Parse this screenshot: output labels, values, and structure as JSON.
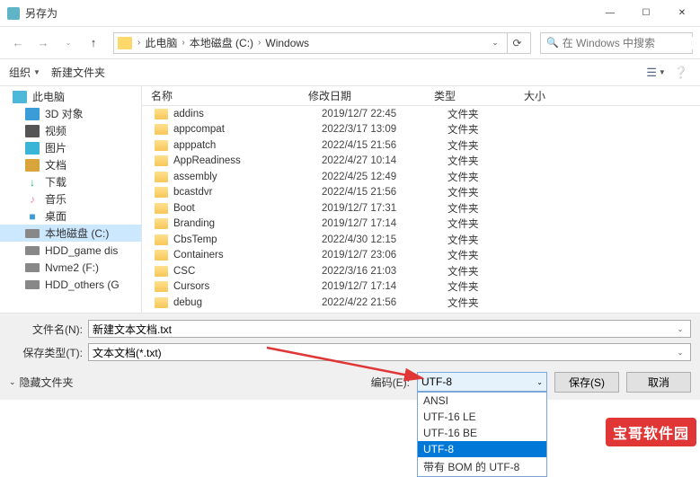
{
  "window": {
    "title": "另存为",
    "close": "✕",
    "max": "☐",
    "min": "—"
  },
  "nav": {
    "back": "←",
    "fwd": "→",
    "up": "↑",
    "crumbs": [
      "此电脑",
      "本地磁盘 (C:)",
      "Windows"
    ],
    "sep": "›",
    "refresh": "⟳",
    "search_placeholder": "在 Windows 中搜索",
    "search_icon": "🔍"
  },
  "toolbar": {
    "organize": "组织",
    "newfolder": "新建文件夹",
    "view_icon": "☰",
    "help_icon": "❔"
  },
  "sidebar": {
    "items": [
      {
        "label": "此电脑",
        "cls": "ic-pc"
      },
      {
        "label": "3D 对象",
        "cls": "ic-3d",
        "sub": true
      },
      {
        "label": "视频",
        "cls": "ic-vid",
        "sub": true
      },
      {
        "label": "图片",
        "cls": "ic-img",
        "sub": true
      },
      {
        "label": "文档",
        "cls": "ic-doc",
        "sub": true
      },
      {
        "label": "下载",
        "cls": "ic-dl",
        "sub": true,
        "glyph": "↓"
      },
      {
        "label": "音乐",
        "cls": "ic-mus",
        "sub": true,
        "glyph": "♪"
      },
      {
        "label": "桌面",
        "cls": "ic-desk",
        "sub": true,
        "glyph": "■"
      },
      {
        "label": "本地磁盘 (C:)",
        "cls": "ic-disk",
        "sub": true,
        "sel": true
      },
      {
        "label": "HDD_game dis",
        "cls": "ic-disk",
        "sub": true
      },
      {
        "label": "Nvme2 (F:)",
        "cls": "ic-disk",
        "sub": true
      },
      {
        "label": "HDD_others (G",
        "cls": "ic-disk",
        "sub": true
      }
    ]
  },
  "columns": {
    "name": "名称",
    "date": "修改日期",
    "type": "类型",
    "size": "大小"
  },
  "files": [
    {
      "name": "addins",
      "date": "2019/12/7 22:45",
      "type": "文件夹"
    },
    {
      "name": "appcompat",
      "date": "2022/3/17 13:09",
      "type": "文件夹"
    },
    {
      "name": "apppatch",
      "date": "2022/4/15 21:56",
      "type": "文件夹"
    },
    {
      "name": "AppReadiness",
      "date": "2022/4/27 10:14",
      "type": "文件夹"
    },
    {
      "name": "assembly",
      "date": "2022/4/25 12:49",
      "type": "文件夹"
    },
    {
      "name": "bcastdvr",
      "date": "2022/4/15 21:56",
      "type": "文件夹"
    },
    {
      "name": "Boot",
      "date": "2019/12/7 17:31",
      "type": "文件夹"
    },
    {
      "name": "Branding",
      "date": "2019/12/7 17:14",
      "type": "文件夹"
    },
    {
      "name": "CbsTemp",
      "date": "2022/4/30 12:15",
      "type": "文件夹"
    },
    {
      "name": "Containers",
      "date": "2019/12/7 23:06",
      "type": "文件夹"
    },
    {
      "name": "CSC",
      "date": "2022/3/16 21:03",
      "type": "文件夹"
    },
    {
      "name": "Cursors",
      "date": "2019/12/7 17:14",
      "type": "文件夹"
    },
    {
      "name": "debug",
      "date": "2022/4/22 21:56",
      "type": "文件夹"
    }
  ],
  "bottom": {
    "filename_label": "文件名(N):",
    "filename_value": "新建文本文档.txt",
    "filetype_label": "保存类型(T):",
    "filetype_value": "文本文档(*.txt)",
    "hide_folders": "隐藏文件夹",
    "encoding_label": "编码(E):",
    "encoding_value": "UTF-8",
    "encoding_options": [
      "ANSI",
      "UTF-16 LE",
      "UTF-16 BE",
      "UTF-8",
      "带有 BOM 的 UTF-8"
    ],
    "save": "保存(S)",
    "cancel": "取消"
  },
  "watermark": "宝哥软件园"
}
